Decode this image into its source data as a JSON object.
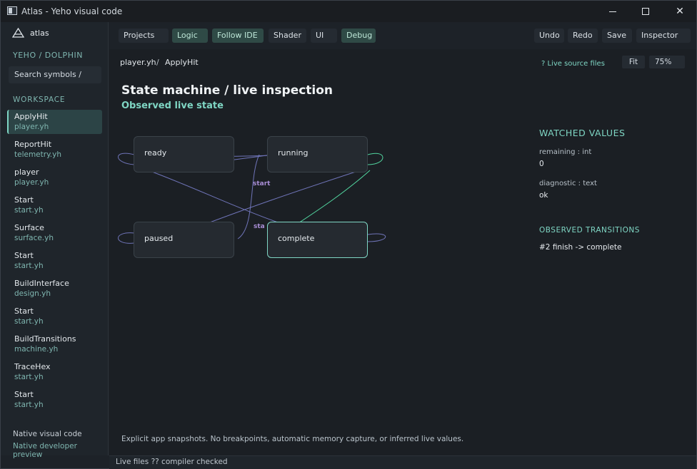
{
  "window": {
    "title": "Atlas - Yeho visual code",
    "controls": {
      "minimize": "minimize",
      "maximize": "maximize",
      "close": "✕"
    }
  },
  "sidebar": {
    "brand": "atlas",
    "project": "YEHO / DOLPHIN",
    "search_text": "Search symbols  /",
    "workspace_label": "WORKSPACE",
    "items": [
      {
        "name": "ApplyHit",
        "file": "player.yh",
        "active": true
      },
      {
        "name": "ReportHit",
        "file": "telemetry.yh"
      },
      {
        "name": "player",
        "file": "player.yh"
      },
      {
        "name": "Start",
        "file": "start.yh"
      },
      {
        "name": "Surface",
        "file": "surface.yh"
      },
      {
        "name": "Start",
        "file": "start.yh"
      },
      {
        "name": "BuildInterface",
        "file": "design.yh"
      },
      {
        "name": "Start",
        "file": "start.yh"
      },
      {
        "name": "BuildTransitions",
        "file": "machine.yh"
      },
      {
        "name": "TraceHex",
        "file": "start.yh"
      },
      {
        "name": "Start",
        "file": "start.yh"
      }
    ],
    "footer_1": "Native visual code",
    "footer_2": "Native developer preview"
  },
  "toolbar": {
    "left": [
      {
        "label": "Projects",
        "active": false
      },
      {
        "label": "Logic",
        "active": true
      },
      {
        "label": "Follow IDE",
        "active": true
      },
      {
        "label": "Shader",
        "active": false
      },
      {
        "label": "UI",
        "active": false
      },
      {
        "label": "Debug",
        "active": true
      }
    ],
    "right": [
      "Undo",
      "Redo",
      "Save",
      "Inspector"
    ]
  },
  "main": {
    "path_file": "player.yh",
    "path_sep": "/",
    "path_symbol": "ApplyHit",
    "live_source": "?  Live source files",
    "fit_label": "Fit",
    "zoom_label": "75%",
    "title": "State machine / live inspection",
    "subtitle": "Observed live state",
    "states": [
      {
        "name": "ready",
        "current": false
      },
      {
        "name": "running",
        "current": false
      },
      {
        "name": "paused",
        "current": false
      },
      {
        "name": "complete",
        "current": true
      }
    ],
    "edge_labels": [
      "start",
      "start"
    ],
    "edge_color": "#6f74b8",
    "live_edge_color": "#52d6a0",
    "footnote": "Explicit app snapshots. No breakpoints, automatic memory capture, or inferred live values."
  },
  "inspector": {
    "watched_title": "WATCHED VALUES",
    "watched": [
      {
        "name": "remaining : int",
        "value": "0"
      },
      {
        "name": "diagnostic : text",
        "value": "ok"
      }
    ],
    "transitions_title": "OBSERVED TRANSITIONS",
    "transitions": [
      "#2  finish -> complete"
    ]
  },
  "status": "Live files ?? compiler checked",
  "colors": {
    "accent": "#7fd6c4",
    "active_bg": "#2f4a46",
    "bg": "#1b1f24"
  }
}
